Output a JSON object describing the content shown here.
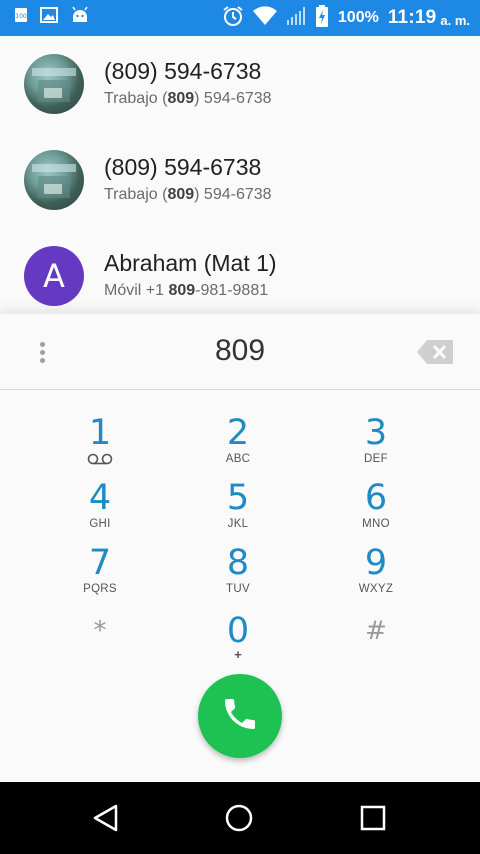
{
  "status_bar": {
    "battery_percent": "100%",
    "time": "11:19",
    "ampm": "a. m.",
    "color": "#1e88e5",
    "icons": [
      "notification-icon",
      "image-icon",
      "android-icon",
      "alarm-icon",
      "wifi-icon",
      "signal-icon",
      "battery-charging-icon"
    ]
  },
  "contacts": [
    {
      "name": "(809) 594-6738",
      "detail_prefix": "Trabajo (",
      "detail_match": "809",
      "detail_suffix": ") 594-6738",
      "avatar": "photo"
    },
    {
      "name": "(809) 594-6738",
      "detail_prefix": "Trabajo (",
      "detail_match": "809",
      "detail_suffix": ") 594-6738",
      "avatar": "photo"
    },
    {
      "name": "Abraham (Mat 1)",
      "detail_prefix": "Móvil +1 ",
      "detail_match": "809",
      "detail_suffix": "-981-9881",
      "avatar": "letter",
      "avatar_letter": "A",
      "avatar_color": "#6639c2"
    }
  ],
  "dialer": {
    "digits": "809",
    "overflow_icon": "more-vert-icon",
    "backspace_icon": "backspace-icon"
  },
  "keypad": [
    {
      "num": "1",
      "letters": "",
      "icon": "voicemail-icon"
    },
    {
      "num": "2",
      "letters": "ABC"
    },
    {
      "num": "3",
      "letters": "DEF"
    },
    {
      "num": "4",
      "letters": "GHI"
    },
    {
      "num": "5",
      "letters": "JKL"
    },
    {
      "num": "6",
      "letters": "MNO"
    },
    {
      "num": "7",
      "letters": "PQRS"
    },
    {
      "num": "8",
      "letters": "TUV"
    },
    {
      "num": "9",
      "letters": "WXYZ"
    },
    {
      "num": "*",
      "letters": ""
    },
    {
      "num": "0",
      "letters": "+"
    },
    {
      "num": "#",
      "letters": ""
    }
  ],
  "call_button": {
    "icon": "phone-icon",
    "color": "#1ec253"
  },
  "nav": {
    "icons": [
      "back-icon",
      "home-icon",
      "recents-icon"
    ]
  }
}
